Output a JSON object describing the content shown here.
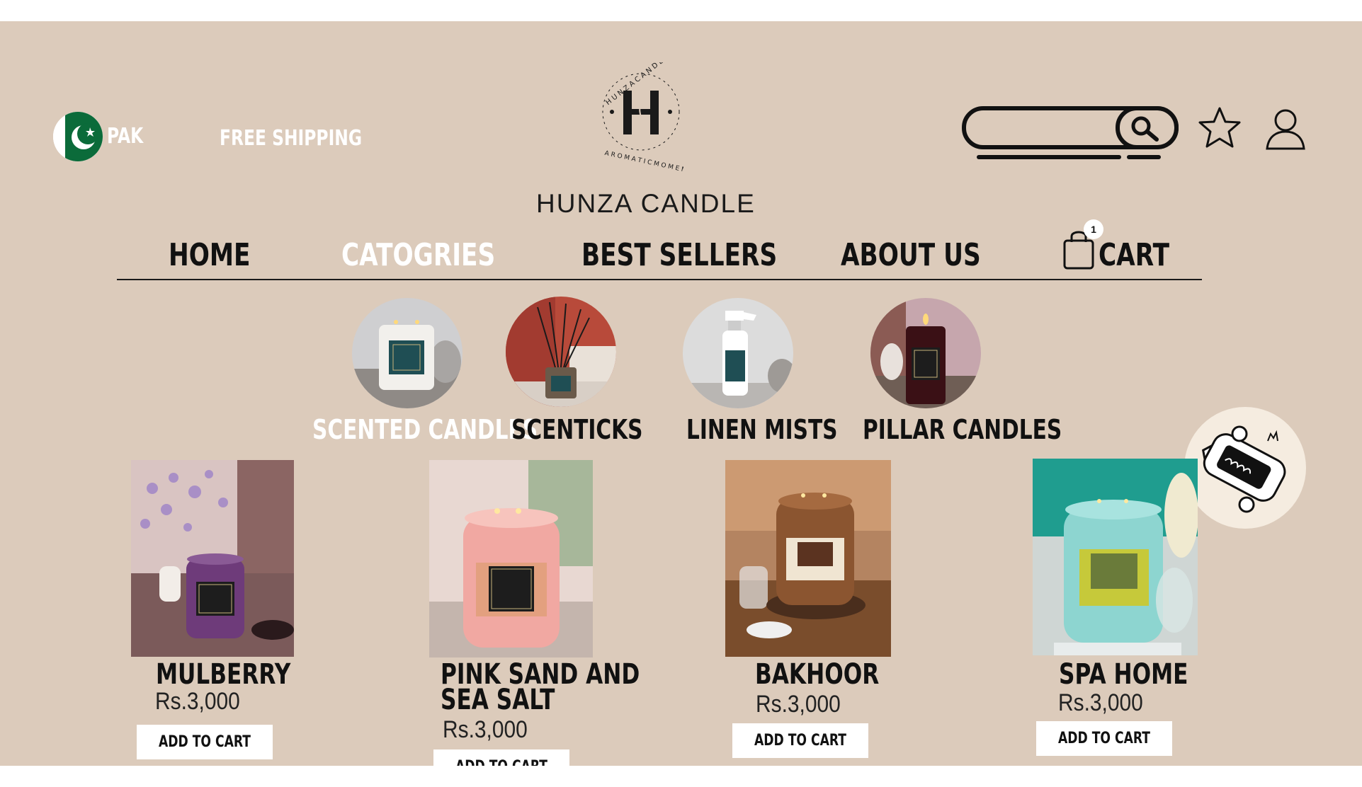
{
  "header": {
    "country": "PAK",
    "shipping": "FREE SHIPPING",
    "brand": "HUNZA CANDLE",
    "logo_text": "HUNZA CANDLE · AROMATIC MOMENTS"
  },
  "nav": {
    "items": [
      {
        "label": "HOME"
      },
      {
        "label": "CATOGRIES"
      },
      {
        "label": "BEST SELLERS"
      },
      {
        "label": "ABOUT US"
      }
    ],
    "cart_label": "CART",
    "cart_count": "1"
  },
  "categories": [
    {
      "label": "SCENTED CANDLES",
      "icon": "scented-candle-photo"
    },
    {
      "label": "SCENTICKS",
      "icon": "reed-diffuser-photo"
    },
    {
      "label": "LINEN MISTS",
      "icon": "spray-bottle-photo"
    },
    {
      "label": "PILLAR CANDLES",
      "icon": "pillar-candle-photo"
    }
  ],
  "products": [
    {
      "name": "MULBERRY",
      "price": "Rs.3,000",
      "button": "ADD TO CART"
    },
    {
      "name_line1": "PINK SAND AND",
      "name_line2": "SEA SALT",
      "price": "Rs.3,000",
      "button": "ADD TO CART"
    },
    {
      "name": "BAKHOOR",
      "price": "Rs.3,000",
      "button": "ADD TO CART"
    },
    {
      "name": "SPA HOME",
      "price": "Rs.3,000",
      "button": "ADD TO CART"
    }
  ],
  "colors": {
    "background": "#dccbbb",
    "accent_white": "#ffffff",
    "text": "#111111",
    "flag_green": "#0b6b3a"
  }
}
